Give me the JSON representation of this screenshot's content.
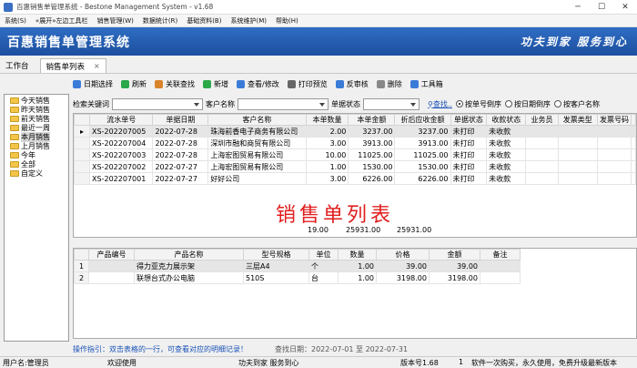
{
  "window": {
    "title": "百惠销售单管理系统 - Bestone Management System - v1.68",
    "controls": [
      "─",
      "☐",
      "✕"
    ]
  },
  "menu": [
    "系统(S)",
    "«展开»左边工具栏",
    "销售管理(W)",
    "数据统计(R)",
    "基础资料(B)",
    "系统维护(M)",
    "帮助(H)"
  ],
  "banner": {
    "title": "百惠销售单管理系统",
    "slogan": "功夫到家  服务到心",
    "color": "#2563b8"
  },
  "tabs": {
    "workbench": "工作台",
    "active": "销售单列表",
    "close": "×"
  },
  "toolbar": [
    {
      "label": "日期选择",
      "icon": "calendar-icon",
      "color": "#3b7bd8"
    },
    {
      "label": "刷新",
      "icon": "refresh-icon",
      "color": "#2aa84a"
    },
    {
      "label": "关联查找",
      "icon": "link-search-icon",
      "color": "#d9832a"
    },
    {
      "label": "新增",
      "icon": "add-icon",
      "color": "#2aa84a"
    },
    {
      "label": "查看/修改",
      "icon": "edit-icon",
      "color": "#3b7bd8"
    },
    {
      "label": "打印预览",
      "icon": "print-icon",
      "color": "#666666"
    },
    {
      "label": "反审核",
      "icon": "unaudit-icon",
      "color": "#3b7bd8"
    },
    {
      "label": "删除",
      "icon": "delete-icon",
      "color": "#888888"
    },
    {
      "label": "工具箱",
      "icon": "toolbox-icon",
      "color": "#3b7bd8"
    }
  ],
  "sidebar": [
    "今天销售",
    "昨天销售",
    "前天销售",
    "最近一周",
    "本月销售",
    "上月销售",
    "今年",
    "全部",
    "自定义"
  ],
  "sidebar_selected": 4,
  "filter": {
    "keyword_label": "检索关键词",
    "customer_label": "客户名称",
    "status_label": "单据状态",
    "search_label": "查找..",
    "sort_options": [
      "按单号倒序",
      "按日期倒序",
      "按客户名称"
    ],
    "sort_selected": 0
  },
  "orders": {
    "columns": [
      "流水单号",
      "单据日期",
      "客户名称",
      "本单数量",
      "本单金额",
      "折后应收金额",
      "单据状态",
      "收款状态",
      "业务员",
      "发票类型",
      "发票号码"
    ],
    "rows": [
      [
        "XS-202207005",
        "2022-07-28",
        "珠海前香电子商务有限公司",
        "2.00",
        "3237.00",
        "3237.00",
        "未打印",
        "未收款",
        "",
        "",
        ""
      ],
      [
        "XS-202207004",
        "2022-07-28",
        "深圳市融和商贸有限公司",
        "3.00",
        "3913.00",
        "3913.00",
        "未打印",
        "未收款",
        "",
        "",
        ""
      ],
      [
        "XS-202207003",
        "2022-07-28",
        "上海宏图贸易有限公司",
        "10.00",
        "11025.00",
        "11025.00",
        "未打印",
        "未收款",
        "",
        "",
        ""
      ],
      [
        "XS-202207002",
        "2022-07-27",
        "上海宏图贸易有限公司",
        "1.00",
        "1530.00",
        "1530.00",
        "未打印",
        "未收款",
        "",
        "",
        ""
      ],
      [
        "XS-202207001",
        "2022-07-27",
        "好好公司",
        "3.00",
        "6226.00",
        "6226.00",
        "未打印",
        "未收款",
        "",
        "",
        ""
      ]
    ],
    "totals": {
      "qty": "19.00",
      "amount": "25931.00",
      "receivable": "25931.00"
    },
    "watermark": "销售单列表"
  },
  "items": {
    "columns": [
      "产品编号",
      "产品名称",
      "型号规格",
      "单位",
      "数量",
      "价格",
      "金额",
      "备注"
    ],
    "rows": [
      [
        "",
        "得力亚克力展示架",
        "三层A4",
        "个",
        "1.00",
        "39.00",
        "39.00",
        ""
      ],
      [
        "",
        "联想台式办公电脑",
        "510S",
        "台",
        "1.00",
        "3198.00",
        "3198.00",
        ""
      ]
    ]
  },
  "guide": "操作指引：双击表格的一行，可查看对应的明细记录！",
  "range": "查找日期：2022-07-01 至 2022-07-31",
  "status": {
    "user": "用户名:管理员",
    "welcome": "欢迎使用",
    "motto": "功夫到家  服务到心",
    "version": "版本号1.68",
    "count": "1",
    "promo": "软件一次购买，永久使用，免费升级最新版本"
  }
}
